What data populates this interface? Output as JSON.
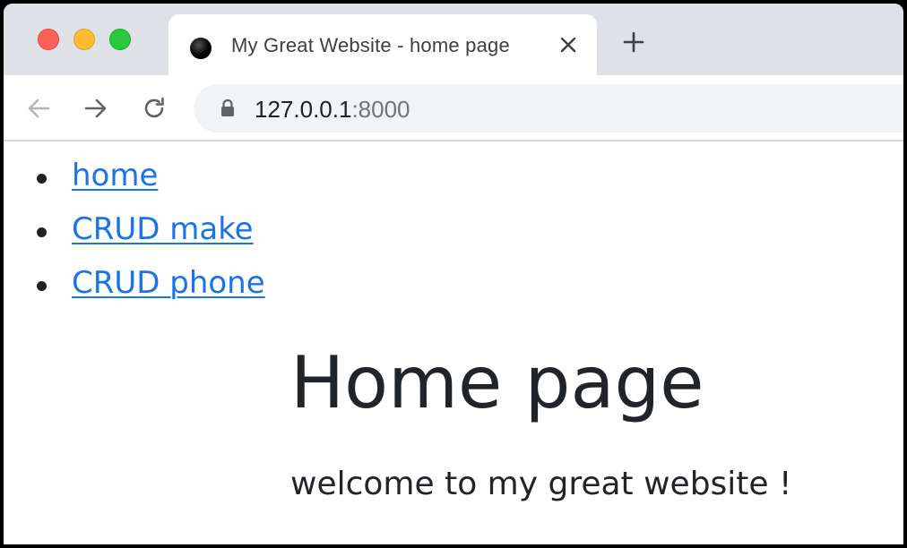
{
  "browser": {
    "tab": {
      "title": "My Great Website - home page",
      "favicon": "black-circle-icon",
      "close_icon": "close-icon"
    },
    "new_tab_icon": "plus-icon",
    "toolbar": {
      "back_icon": "arrow-left-icon",
      "forward_icon": "arrow-right-icon",
      "reload_icon": "reload-icon",
      "lock_icon": "lock-icon",
      "url_host": "127.0.0.1",
      "url_port": ":8000"
    },
    "traffic_lights": [
      "#ff5f57",
      "#febc2e",
      "#28c840"
    ]
  },
  "page": {
    "nav": [
      {
        "label": "home"
      },
      {
        "label": "CRUD make"
      },
      {
        "label": "CRUD phone"
      }
    ],
    "heading": "Home page",
    "welcome": "welcome to my great website !",
    "link_color": "#1a73e8",
    "text_color": "#212529"
  }
}
